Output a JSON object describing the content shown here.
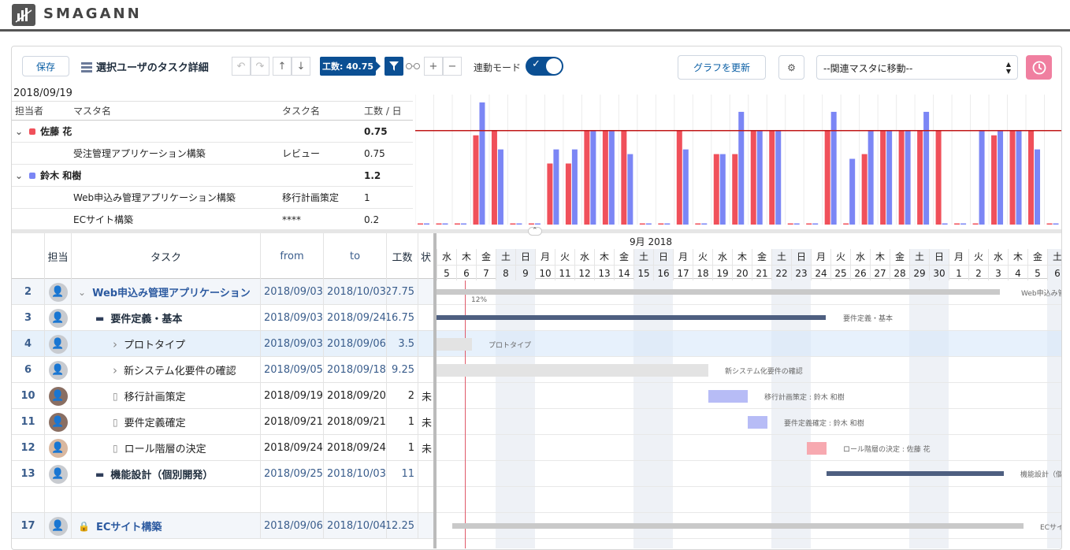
{
  "app": {
    "brand": "SMAGANN"
  },
  "toolbar": {
    "save": "保存",
    "title": "選択ユーザのタスク詳細",
    "badge": "工数: 40.75",
    "sync_label": "連動モード",
    "update_graph": "グラフを更新",
    "select_value": "--関連マスタに移動--",
    "colors": {
      "accent": "#0b4f93",
      "clock": "#f07fa0"
    }
  },
  "summary": {
    "date": "2018/09/19",
    "headers": [
      "担当者",
      "マスタ名",
      "タスク名",
      "工数 / 日"
    ],
    "groups": [
      {
        "name": "佐藤 花",
        "color": "#f0505a",
        "total": "0.75",
        "rows": [
          {
            "master": "受注管理アプリケーション構築",
            "task": "レビュー",
            "value": "0.75"
          }
        ]
      },
      {
        "name": "鈴木 和樹",
        "color": "#7b86f5",
        "total": "1.2",
        "rows": [
          {
            "master": "Web申込み管理アプリケーション構築",
            "task": "移行計画策定",
            "value": "1"
          },
          {
            "master": "ECサイト構築",
            "task": "****",
            "value": "0.2"
          }
        ]
      }
    ]
  },
  "chart_data": {
    "type": "bar",
    "threshold": 1,
    "ylim": [
      0,
      1.3
    ],
    "series": [
      {
        "name": "佐藤 花",
        "color": "#f0505a",
        "values": [
          0,
          0,
          0,
          0.95,
          1,
          0,
          0,
          0.65,
          0.65,
          1,
          1,
          1,
          0,
          0,
          1,
          0,
          0.75,
          0.75,
          1,
          1,
          0,
          0,
          1,
          0,
          0.75,
          1,
          1,
          1,
          1,
          0,
          0,
          0.95,
          1,
          1,
          0
        ]
      },
      {
        "name": "鈴木 和樹",
        "color": "#7b86f5",
        "values": [
          0,
          0,
          0,
          1.3,
          0.8,
          0,
          0,
          0.8,
          0.8,
          1,
          1,
          0.75,
          0,
          0,
          0.8,
          0,
          0.75,
          1.2,
          1,
          1,
          0,
          0,
          1.2,
          0.7,
          1,
          1,
          1,
          1.2,
          0,
          0,
          1,
          1,
          1,
          0.8,
          0
        ]
      }
    ]
  },
  "grid": {
    "headers": {
      "num": "",
      "tanto": "担当",
      "task": "タスク",
      "from": "from",
      "to": "to",
      "kosu": "工数",
      "jo": "状"
    },
    "rows": [
      {
        "num": "2",
        "task": "Web申込み管理アプリケーション",
        "from": "2018/09/03",
        "to": "2018/10/03",
        "kosu": "27.75",
        "jo": "",
        "indent": 0,
        "icon": "chevron-down",
        "style": "parent",
        "avatar": "default"
      },
      {
        "num": "3",
        "task": "要件定義・基本",
        "from": "2018/09/03",
        "to": "2018/09/24",
        "kosu": "16.75",
        "jo": "",
        "indent": 1,
        "icon": "folder",
        "style": "summary",
        "avatar": "default"
      },
      {
        "num": "4",
        "task": "プロトタイプ",
        "from": "2018/09/03",
        "to": "2018/09/06",
        "kosu": "3.5",
        "jo": "",
        "indent": 2,
        "icon": "chevron-right",
        "style": "selected",
        "avatar": "default"
      },
      {
        "num": "6",
        "task": "新システム化要件の確認",
        "from": "2018/09/05",
        "to": "2018/09/18",
        "kosu": "9.25",
        "jo": "",
        "indent": 2,
        "icon": "chevron-right",
        "style": "normal",
        "avatar": "default"
      },
      {
        "num": "10",
        "task": "移行計画策定",
        "from": "2018/09/19",
        "to": "2018/09/20",
        "kosu": "2",
        "jo": "未",
        "indent": 2,
        "icon": "file",
        "style": "leaf",
        "avatar": "photo"
      },
      {
        "num": "11",
        "task": "要件定義確定",
        "from": "2018/09/21",
        "to": "2018/09/21",
        "kosu": "1",
        "jo": "未",
        "indent": 2,
        "icon": "file",
        "style": "leaf",
        "avatar": "photo"
      },
      {
        "num": "12",
        "task": "ロール階層の決定",
        "from": "2018/09/24",
        "to": "2018/09/24",
        "kosu": "1",
        "jo": "未",
        "indent": 2,
        "icon": "file",
        "style": "leaf",
        "avatar": "female"
      },
      {
        "num": "13",
        "task": "機能設計（個別開発）",
        "from": "2018/09/25",
        "to": "2018/10/03",
        "kosu": "11",
        "jo": "",
        "indent": 1,
        "icon": "folder",
        "style": "summary2",
        "avatar": "default"
      },
      {
        "num": "",
        "task": "",
        "from": "",
        "to": "",
        "kosu": "",
        "jo": "",
        "indent": 0,
        "icon": "none",
        "style": "blank",
        "avatar": "none"
      },
      {
        "num": "17",
        "task": "ECサイト構築",
        "from": "2018/09/06",
        "to": "2018/10/04",
        "kosu": "12.25",
        "jo": "",
        "indent": 0,
        "icon": "lock",
        "style": "parent",
        "avatar": "default"
      }
    ]
  },
  "gantt": {
    "month": "9月 2018",
    "days": [
      "水",
      "木",
      "金",
      "土",
      "日",
      "月",
      "火",
      "水",
      "木",
      "金",
      "土",
      "日",
      "月",
      "火",
      "水",
      "木",
      "金",
      "土",
      "日",
      "月",
      "火",
      "水",
      "木",
      "金",
      "土",
      "日",
      "月",
      "火",
      "水",
      "木",
      "金",
      "土"
    ],
    "dates": [
      "5",
      "6",
      "7",
      "8",
      "9",
      "10",
      "11",
      "12",
      "13",
      "14",
      "15",
      "16",
      "17",
      "18",
      "19",
      "20",
      "21",
      "22",
      "23",
      "24",
      "25",
      "26",
      "27",
      "28",
      "29",
      "30",
      "1",
      "2",
      "3",
      "4",
      "5",
      "6"
    ],
    "labels": [
      "Web申込み管",
      "12%",
      "要件定義・基本",
      "プロトタイプ",
      "新システム化要件の確認",
      "移行計画策定 : 鈴木 和樹",
      "要件定義確定 : 鈴木 和樹",
      "ロール階層の決定 : 佐藤 花",
      "機能設計（個",
      "ECサイト"
    ]
  }
}
